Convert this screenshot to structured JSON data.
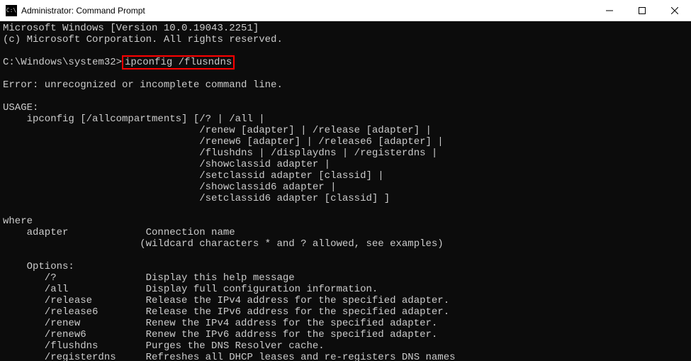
{
  "titlebar": {
    "title": "Administrator: Command Prompt"
  },
  "terminal": {
    "line_version": "Microsoft Windows [Version 10.0.19043.2251]",
    "line_copyright": "(c) Microsoft Corporation. All rights reserved.",
    "prompt_path": "C:\\Windows\\system32>",
    "typed_command": "ipconfig /flusndns",
    "error_line": "Error: unrecognized or incomplete command line.",
    "usage_header": "USAGE:",
    "usage_line1": "    ipconfig [/allcompartments] [/? | /all |",
    "usage_line2": "                                 /renew [adapter] | /release [adapter] |",
    "usage_line3": "                                 /renew6 [adapter] | /release6 [adapter] |",
    "usage_line4": "                                 /flushdns | /displaydns | /registerdns |",
    "usage_line5": "                                 /showclassid adapter |",
    "usage_line6": "                                 /setclassid adapter [classid] |",
    "usage_line7": "                                 /showclassid6 adapter |",
    "usage_line8": "                                 /setclassid6 adapter [classid] ]",
    "where_header": "where",
    "where_line1": "    adapter             Connection name",
    "where_line2": "                       (wildcard characters * and ? allowed, see examples)",
    "options_header": "    Options:",
    "opt_help": "       /?               Display this help message",
    "opt_all": "       /all             Display full configuration information.",
    "opt_release": "       /release         Release the IPv4 address for the specified adapter.",
    "opt_release6": "       /release6        Release the IPv6 address for the specified adapter.",
    "opt_renew": "       /renew           Renew the IPv4 address for the specified adapter.",
    "opt_renew6": "       /renew6          Renew the IPv6 address for the specified adapter.",
    "opt_flushdns": "       /flushdns        Purges the DNS Resolver cache.",
    "opt_registerdns": "       /registerdns     Refreshes all DHCP leases and re-registers DNS names"
  }
}
